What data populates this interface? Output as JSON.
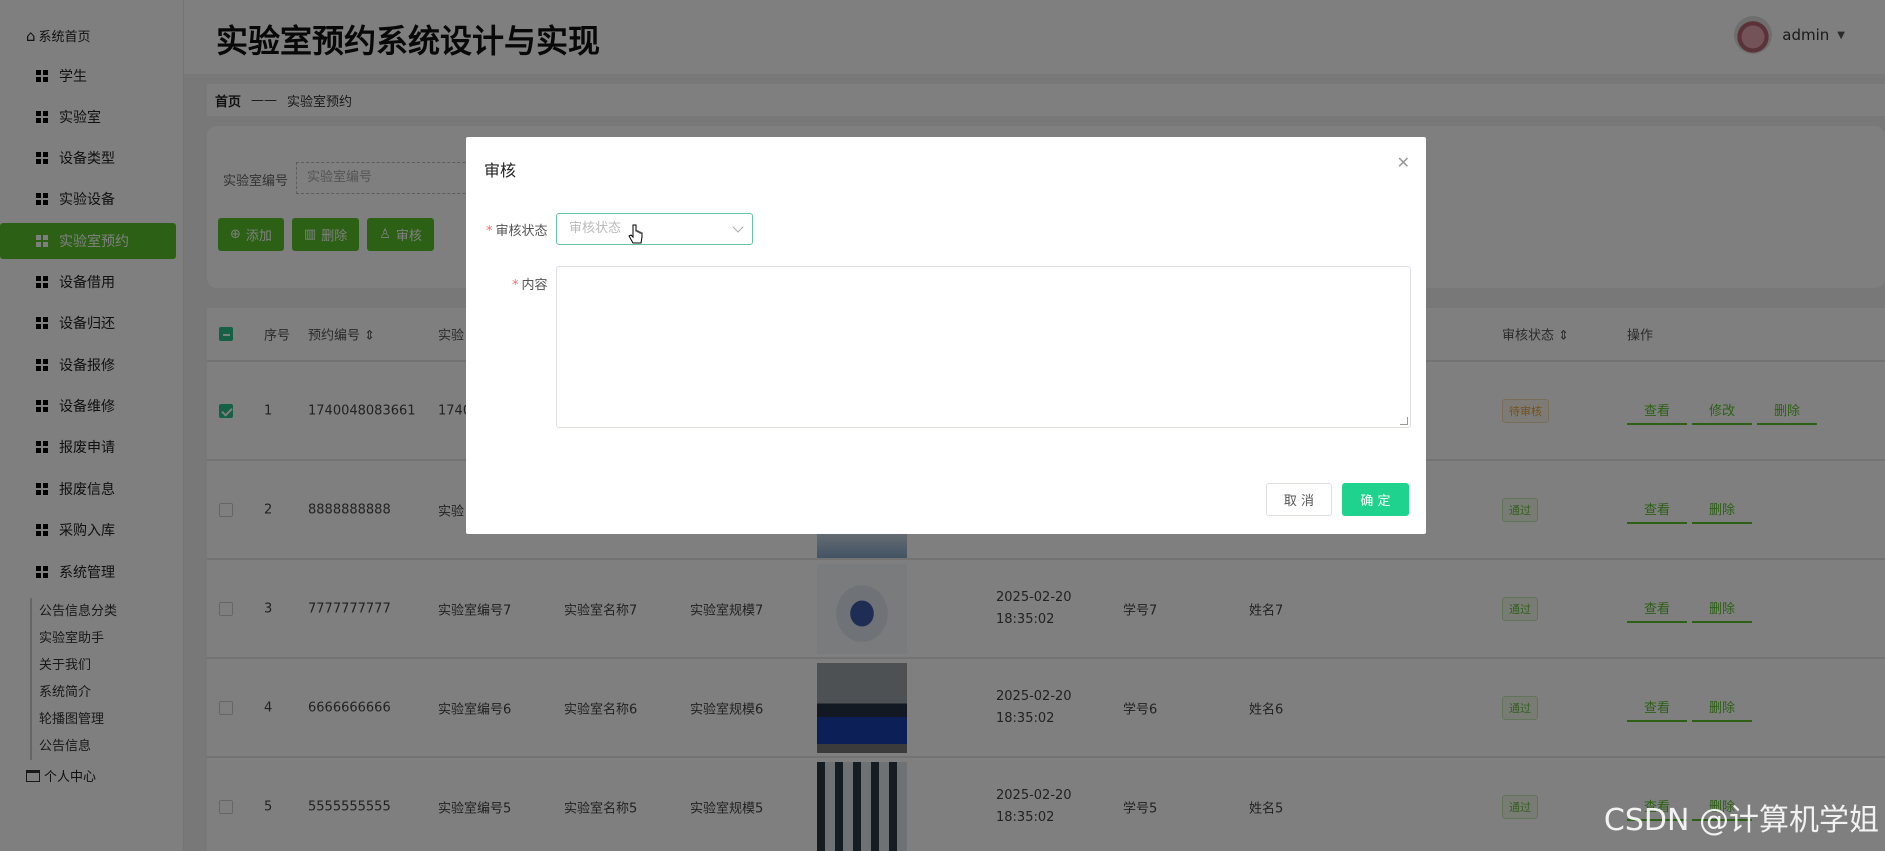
{
  "sidebar": {
    "home": "系统首页",
    "items": [
      {
        "label": "学生",
        "icon": "grid-icon"
      },
      {
        "label": "实验室",
        "icon": "grid-icon"
      },
      {
        "label": "设备类型",
        "icon": "grid-icon"
      },
      {
        "label": "实验设备",
        "icon": "device-icon"
      },
      {
        "label": "实验室预约",
        "icon": "grid-icon"
      },
      {
        "label": "设备借用",
        "icon": "grid-icon"
      },
      {
        "label": "设备归还",
        "icon": "briefcase-icon"
      },
      {
        "label": "设备报修",
        "icon": "grid-icon"
      },
      {
        "label": "设备维修",
        "icon": "person-icon"
      },
      {
        "label": "报废申请",
        "icon": "clipboard-icon"
      },
      {
        "label": "报废信息",
        "icon": "grid-icon"
      },
      {
        "label": "采购入库",
        "icon": "cart-icon"
      },
      {
        "label": "系统管理",
        "icon": "grid-icon"
      }
    ],
    "sub_items": [
      "公告信息分类",
      "实验室助手",
      "关于我们",
      "系统简介",
      "轮播图管理",
      "公告信息"
    ],
    "personal": "个人中心"
  },
  "header": {
    "title": "实验室预约系统设计与实现",
    "user": "admin"
  },
  "breadcrumb": {
    "home": "首页",
    "sep": "——",
    "current": "实验室预约"
  },
  "search": {
    "label": "实验室编号",
    "placeholder": "实验室编号"
  },
  "buttons": {
    "add": "添加",
    "delete": "删除",
    "audit": "审核"
  },
  "table": {
    "headers": {
      "index": "序号",
      "booking_no": "预约编号",
      "lab_no": "实验",
      "audit_status": "审核状态",
      "ops": "操作"
    },
    "rows": [
      {
        "idx": "1",
        "no": "1740048083661",
        "lab_no": "1740",
        "lab_name": "",
        "scale": "",
        "date": "",
        "sid": "",
        "sname": "",
        "status": "待审核",
        "ops": [
          "查看",
          "修改",
          "删除"
        ]
      },
      {
        "idx": "2",
        "no": "8888888888",
        "lab_no": "实验",
        "lab_name": "",
        "scale": "",
        "date": "",
        "sid": "",
        "sname": "",
        "status": "通过",
        "ops": [
          "查看",
          "删除"
        ]
      },
      {
        "idx": "3",
        "no": "7777777777",
        "lab_no": "实验室编号7",
        "lab_name": "实验室名称7",
        "scale": "实验室规模7",
        "date": "2025-02-20 18:35:02",
        "sid": "学号7",
        "sname": "姓名7",
        "status": "通过",
        "ops": [
          "查看",
          "删除"
        ]
      },
      {
        "idx": "4",
        "no": "6666666666",
        "lab_no": "实验室编号6",
        "lab_name": "实验室名称6",
        "scale": "实验室规模6",
        "date": "2025-02-20 18:35:02",
        "sid": "学号6",
        "sname": "姓名6",
        "status": "通过",
        "ops": [
          "查看",
          "删除"
        ]
      },
      {
        "idx": "5",
        "no": "5555555555",
        "lab_no": "实验室编号5",
        "lab_name": "实验室名称5",
        "scale": "实验室规模5",
        "date": "2025-02-20 18:35:02",
        "sid": "学号5",
        "sname": "姓名5",
        "status": "通过",
        "ops": [
          "查看",
          "删除"
        ]
      }
    ]
  },
  "modal": {
    "title": "审核",
    "status_label": "审核状态",
    "status_placeholder": "审核状态",
    "content_label": "内容",
    "cancel": "取 消",
    "ok": "确 定"
  },
  "watermark": "CSDN @计算机学姐"
}
